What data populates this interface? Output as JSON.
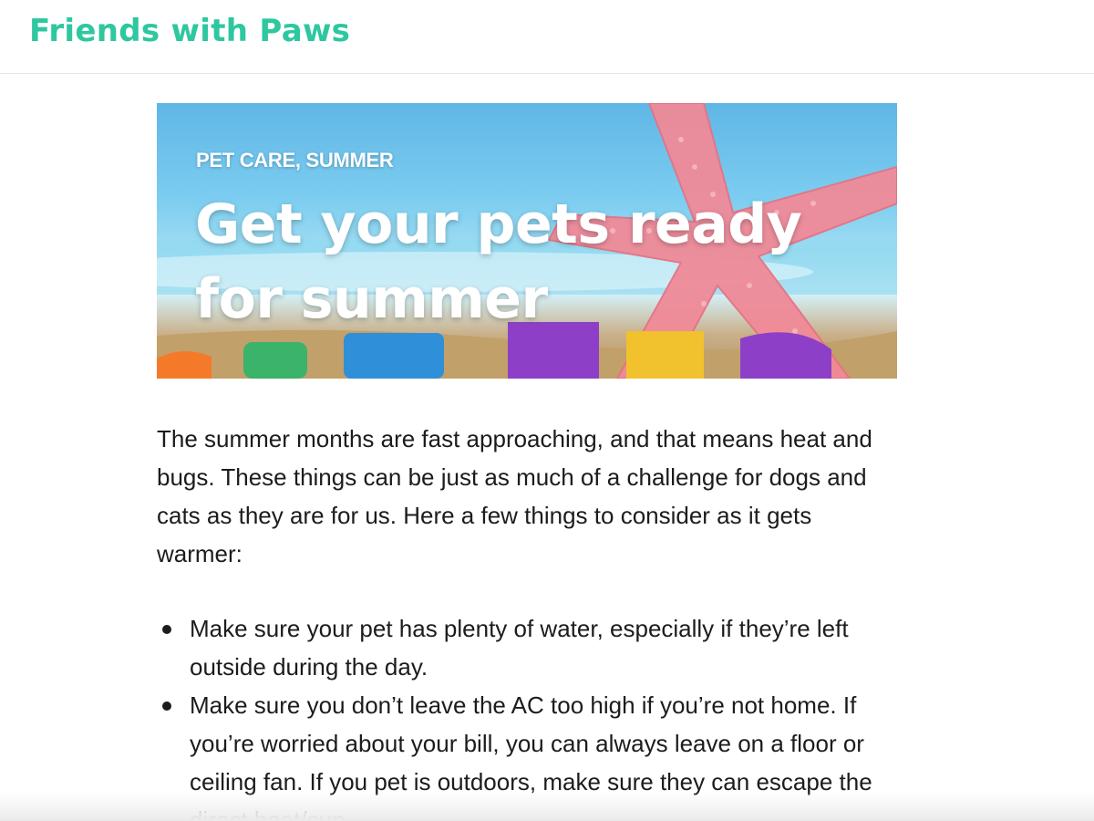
{
  "site": {
    "title": "Friends with Paws"
  },
  "hero": {
    "category": "PET CARE, SUMMER",
    "title": "Get your pets ready for summer"
  },
  "article": {
    "intro": "The summer months are fast approaching, and that means heat and bugs. These things can be just as much of a challenge for dogs and cats as they are for us. Here a few things to consider as it gets warmer:",
    "tips": [
      "Make sure your pet has plenty of water, especially if they’re left outside during the day.",
      "Make sure you don’t leave the AC too high if you’re not home. If you’re worried about your bill, you can always leave on a floor or ceiling fan. If you pet is outdoors, make sure they can escape the direct heat/sun."
    ]
  },
  "colors": {
    "brand": "#2ec7a0",
    "text": "#1c1c1c",
    "hero_sky": "#5fb6e6",
    "starfish": "#f08a98"
  }
}
